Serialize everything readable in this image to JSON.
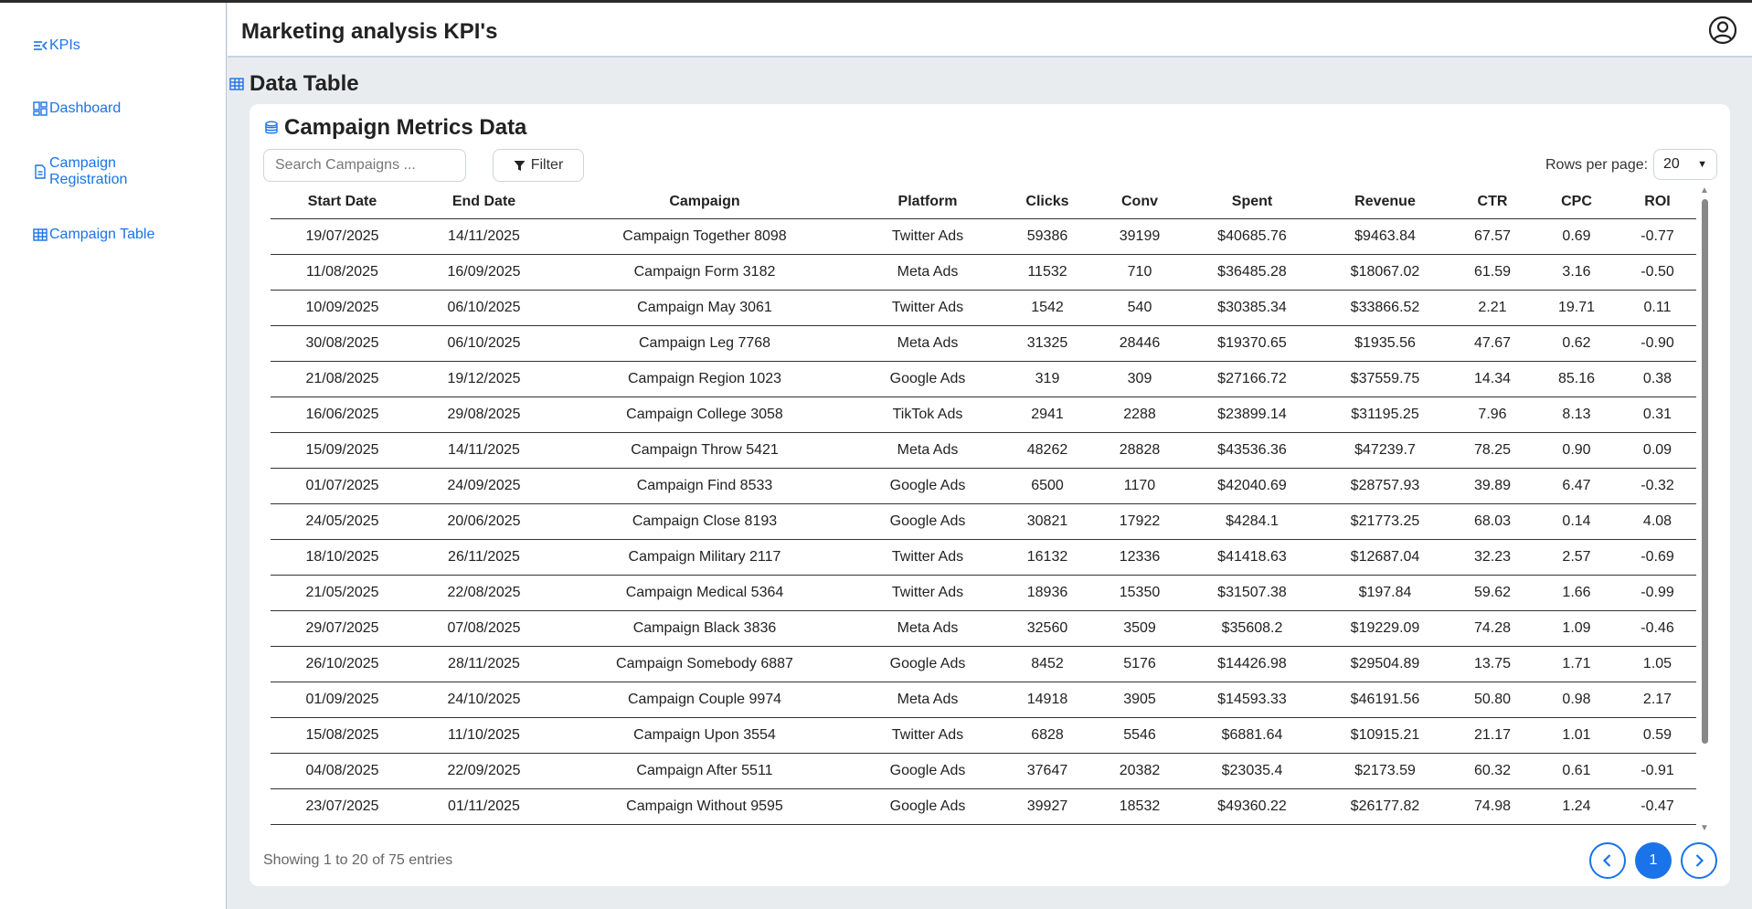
{
  "sidebar": {
    "items": [
      {
        "label": "KPIs",
        "icon": "menu-collapse-icon"
      },
      {
        "label": "Dashboard",
        "icon": "dashboard-icon"
      },
      {
        "label": "Campaign Registration",
        "line1": "Campaign",
        "line2": "Registration",
        "icon": "document-icon"
      },
      {
        "label": "Campaign Table",
        "icon": "table-icon"
      }
    ]
  },
  "header": {
    "title": "Marketing analysis KPI's",
    "profile_icon": "user-circle-icon"
  },
  "section": {
    "title": "Data Table",
    "icon": "table-icon"
  },
  "card": {
    "title": "Campaign Metrics Data",
    "icon": "database-icon",
    "search_placeholder": "Search Campaigns ...",
    "filter_label": "Filter",
    "rows_per_page_label": "Rows per page:",
    "rows_per_page_value": "20",
    "showing_text": "Showing 1 to 20 of 75 entries",
    "current_page": "1"
  },
  "colors": {
    "accent": "#1a73e8",
    "background": "#e9ecef"
  },
  "table": {
    "columns": [
      "Start Date",
      "End Date",
      "Campaign",
      "Platform",
      "Clicks",
      "Conv",
      "Spent",
      "Revenue",
      "CTR",
      "CPC",
      "ROI"
    ],
    "rows": [
      [
        "19/07/2025",
        "14/11/2025",
        "Campaign Together 8098",
        "Twitter Ads",
        "59386",
        "39199",
        "$40685.76",
        "$9463.84",
        "67.57",
        "0.69",
        "-0.77"
      ],
      [
        "11/08/2025",
        "16/09/2025",
        "Campaign Form 3182",
        "Meta Ads",
        "11532",
        "710",
        "$36485.28",
        "$18067.02",
        "61.59",
        "3.16",
        "-0.50"
      ],
      [
        "10/09/2025",
        "06/10/2025",
        "Campaign May 3061",
        "Twitter Ads",
        "1542",
        "540",
        "$30385.34",
        "$33866.52",
        "2.21",
        "19.71",
        "0.11"
      ],
      [
        "30/08/2025",
        "06/10/2025",
        "Campaign Leg 7768",
        "Meta Ads",
        "31325",
        "28446",
        "$19370.65",
        "$1935.56",
        "47.67",
        "0.62",
        "-0.90"
      ],
      [
        "21/08/2025",
        "19/12/2025",
        "Campaign Region 1023",
        "Google Ads",
        "319",
        "309",
        "$27166.72",
        "$37559.75",
        "14.34",
        "85.16",
        "0.38"
      ],
      [
        "16/06/2025",
        "29/08/2025",
        "Campaign College 3058",
        "TikTok Ads",
        "2941",
        "2288",
        "$23899.14",
        "$31195.25",
        "7.96",
        "8.13",
        "0.31"
      ],
      [
        "15/09/2025",
        "14/11/2025",
        "Campaign Throw 5421",
        "Meta Ads",
        "48262",
        "28828",
        "$43536.36",
        "$47239.7",
        "78.25",
        "0.90",
        "0.09"
      ],
      [
        "01/07/2025",
        "24/09/2025",
        "Campaign Find 8533",
        "Google Ads",
        "6500",
        "1170",
        "$42040.69",
        "$28757.93",
        "39.89",
        "6.47",
        "-0.32"
      ],
      [
        "24/05/2025",
        "20/06/2025",
        "Campaign Close 8193",
        "Google Ads",
        "30821",
        "17922",
        "$4284.1",
        "$21773.25",
        "68.03",
        "0.14",
        "4.08"
      ],
      [
        "18/10/2025",
        "26/11/2025",
        "Campaign Military 2117",
        "Twitter Ads",
        "16132",
        "12336",
        "$41418.63",
        "$12687.04",
        "32.23",
        "2.57",
        "-0.69"
      ],
      [
        "21/05/2025",
        "22/08/2025",
        "Campaign Medical 5364",
        "Twitter Ads",
        "18936",
        "15350",
        "$31507.38",
        "$197.84",
        "59.62",
        "1.66",
        "-0.99"
      ],
      [
        "29/07/2025",
        "07/08/2025",
        "Campaign Black 3836",
        "Meta Ads",
        "32560",
        "3509",
        "$35608.2",
        "$19229.09",
        "74.28",
        "1.09",
        "-0.46"
      ],
      [
        "26/10/2025",
        "28/11/2025",
        "Campaign Somebody 6887",
        "Google Ads",
        "8452",
        "5176",
        "$14426.98",
        "$29504.89",
        "13.75",
        "1.71",
        "1.05"
      ],
      [
        "01/09/2025",
        "24/10/2025",
        "Campaign Couple 9974",
        "Meta Ads",
        "14918",
        "3905",
        "$14593.33",
        "$46191.56",
        "50.80",
        "0.98",
        "2.17"
      ],
      [
        "15/08/2025",
        "11/10/2025",
        "Campaign Upon 3554",
        "Twitter Ads",
        "6828",
        "5546",
        "$6881.64",
        "$10915.21",
        "21.17",
        "1.01",
        "0.59"
      ],
      [
        "04/08/2025",
        "22/09/2025",
        "Campaign After 5511",
        "Google Ads",
        "37647",
        "20382",
        "$23035.4",
        "$2173.59",
        "60.32",
        "0.61",
        "-0.91"
      ],
      [
        "23/07/2025",
        "01/11/2025",
        "Campaign Without 9595",
        "Google Ads",
        "39927",
        "18532",
        "$49360.22",
        "$26177.82",
        "74.98",
        "1.24",
        "-0.47"
      ]
    ]
  }
}
